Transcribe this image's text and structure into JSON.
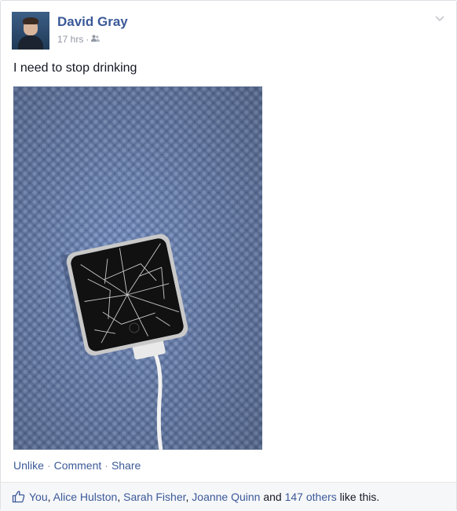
{
  "post": {
    "author": "David Gray",
    "time": "17 hrs",
    "meta_separator": "·",
    "audience_icon": "friends-icon",
    "menu_icon": "chevron-down-icon",
    "text": "I need to stop drinking",
    "photo_subject": "cracked-ipod-nano-photo"
  },
  "actions": {
    "unlike": "Unlike",
    "comment": "Comment",
    "share": "Share",
    "separator": "·"
  },
  "likes": {
    "icon": "thumbs-up-icon",
    "you": "You",
    "comma": ",",
    "people": [
      "Alice Hulston",
      "Sarah Fisher",
      "Joanne Quinn"
    ],
    "and": "and",
    "others": "147 others",
    "suffix": "like this."
  },
  "colors": {
    "link": "#3b5998",
    "meta": "#9197a3",
    "text": "#141823",
    "like_bar_bg": "#f6f7f9"
  }
}
